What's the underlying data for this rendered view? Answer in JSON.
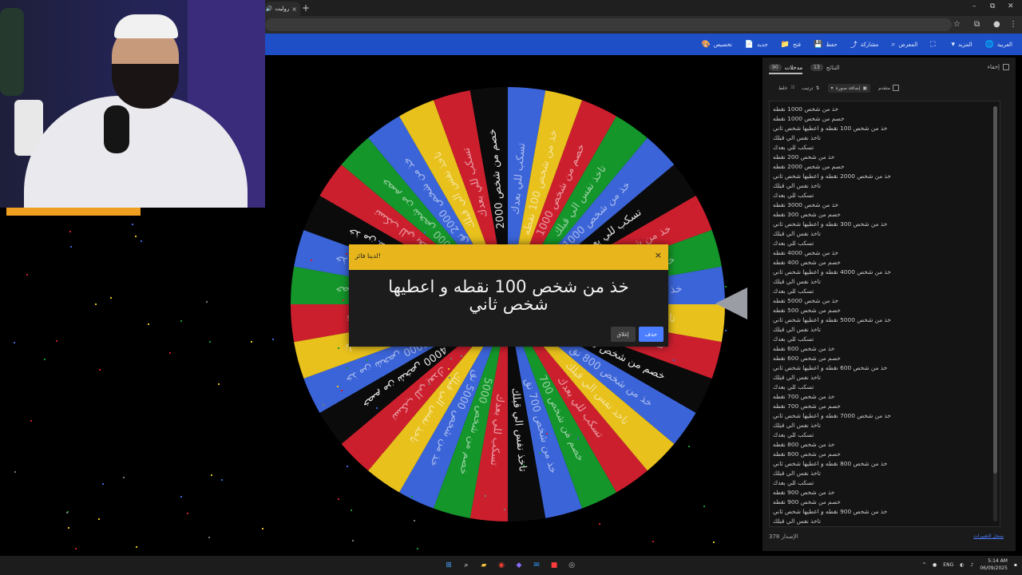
{
  "browser": {
    "tab_title": "روليت",
    "tab_close": "×",
    "new_tab": "+",
    "window_controls": {
      "minimize": "–",
      "restore": "⧉",
      "close": "✕"
    }
  },
  "toolbar": {
    "items": [
      {
        "icon": "globe-icon",
        "glyph": "🌐",
        "label": "العربية"
      },
      {
        "icon": "more-icon",
        "glyph": "▾",
        "label": "المزيد"
      },
      {
        "icon": "fullscreen-icon",
        "glyph": "⛶",
        "label": ""
      },
      {
        "icon": "search-icon",
        "glyph": "⌕",
        "label": "المعرض"
      },
      {
        "icon": "share-icon",
        "glyph": "⤴",
        "label": "مشاركة"
      },
      {
        "icon": "save-icon",
        "glyph": "💾",
        "label": "حفظ"
      },
      {
        "icon": "folder-icon",
        "glyph": "📁",
        "label": "فتح"
      },
      {
        "icon": "new-icon",
        "glyph": "📄",
        "label": "جديد"
      },
      {
        "icon": "palette-icon",
        "glyph": "🎨",
        "label": "تخصيص"
      }
    ]
  },
  "modal": {
    "title": "لدينا فائز!",
    "close": "×",
    "message": "خذ من شخص 100 نقطه و اعطيها شخص ثاني",
    "primary_button": "حذف",
    "secondary_button": "إغلاق"
  },
  "panel": {
    "tab_entries_label": "مدخلات",
    "tab_entries_count": "90",
    "tab_results_label": "النتائج",
    "tab_results_count": "13",
    "hide_label": "إخفاء",
    "controls": {
      "advanced": "متقدم",
      "image": "إضافة صورة",
      "sort": "ترتيب",
      "shuffle": "خلط"
    },
    "version_label": "الإصدار",
    "version_number": "378",
    "changelog": "سجل التغييرات"
  },
  "entries": [
    "خذ من شخص 1000 نقطه",
    "خصم من شخص 1000 نقطه",
    "خذ من شخص 100 نقطه و اعطيها شخص ثاني",
    "تاخذ نفس الي قبلك",
    "تسكب للي بعدك",
    "خذ من شخص 200 نقطه",
    "خصم من شخص 2000 نقطه",
    "خذ من شخص 2000 نقطه و اعطيها شخص ثاني",
    "تاخذ نفس الي قبلك",
    "تسكب للي بعدك",
    "خذ من شخص 3000 نقطه",
    "خصم من شخص 300 نقطه",
    "خذ من شخص 300 نقطه و اعطيها شخص ثاني",
    "تاخذ نفس الي قبلك",
    "تسكب للي بعدك",
    "خذ من شخص 4000 نقطه",
    "خصم من شخص 400 نقطه",
    "خذ من شخص 4000 نقطه و اعطيها شخص ثاني",
    "تاخذ نفس الي قبلك",
    "تسكب للي بعدك",
    "خذ من شخص 5000 نقطه",
    "خصم من شخص 500 نقطه",
    "خذ من شخص 5000 نقطه و اعطيها شخص ثاني",
    "تاخذ نفس الي قبلك",
    "تسكب للي بعدك",
    "خذ من شخص 600 نقطه",
    "خصم من شخص 600 نقطه",
    "خذ من شخص 600 نقطه و اعطيها شخص ثاني",
    "تاخذ نفس الي قبلك",
    "تسكب للي بعدك",
    "خذ من شخص 700 نقطه",
    "خصم من شخص 700 نقطه",
    "خذ من شخص 7000 نقطه و اعطيها شخص ثاني",
    "تاخذ نفس الي قبلك",
    "تسكب للي بعدك",
    "خذ من شخص 800 نقطه",
    "خصم من شخص 800 نقطه",
    "خذ من شخص 800 نقطه و اعطيها شخص ثاني",
    "تاخذ نفس الي قبلك",
    "تسكب للي بعدك",
    "خذ من شخص 900 نقطه",
    "خصم من شخص 900 نقطه",
    "خذ من شخص 900 نقطه و اعطيها شخص ثاني",
    "تاخذ نفس الي قبلك"
  ],
  "wheel": {
    "colors": [
      "#3b64d8",
      "#e8c11c",
      "#cc1f2e",
      "#14962a"
    ],
    "labels": [
      "تسكب للي بعدك",
      "خذ من شخص 100 نقطه",
      "خصم من شخص 1000",
      "تاخذ نفس الي قبلك",
      "خذ من شخص 1000",
      "تسكب للي بعدك",
      "خذ من شخص 10000 ن",
      "خصم من شخص 900",
      "خذ من شخص 900 نق",
      "تاخذ نفس الي قبلك",
      "تسكب للي بعدك",
      "خصم من شخص 800",
      "خذ من شخص 800 نق",
      "تاخذ نفس الي قبلك",
      "تسكب للي بعدك",
      "خصم من شخص 700",
      "خذ من شخص 700 نق",
      "تاخذ نفس الي قبلك",
      "تسكب للي بعدك",
      "خصم من شخص 5000",
      "خذ من شخص 5000 نق",
      "تاخذ نفس الي قبلك",
      "تسكب للي بعدك",
      "خصم من شخص 4000",
      "خذ من شخص 4000 نق",
      "تاخذ نفس الي قبلك",
      "تسكب للي بعدك",
      "خصم من شخص 300",
      "خذ من شخص 3000 نق",
      "خذ من شخص 300 نق",
      "تسكب للي بعدك",
      "خصم من شخص 2000",
      "خذ من شخص 2000 نق",
      "تاخذ نفس الي قبلك",
      "تسكب للي بعدك",
      "خصم من شخص 2000"
    ]
  },
  "taskbar": {
    "lang": "ENG",
    "time": "5:14 AM",
    "date": "06/09/2025"
  },
  "colors": {
    "toolbar_blue": "#1e4fc7",
    "modal_header": "#e8b61c",
    "button_blue": "#4a7dff"
  }
}
